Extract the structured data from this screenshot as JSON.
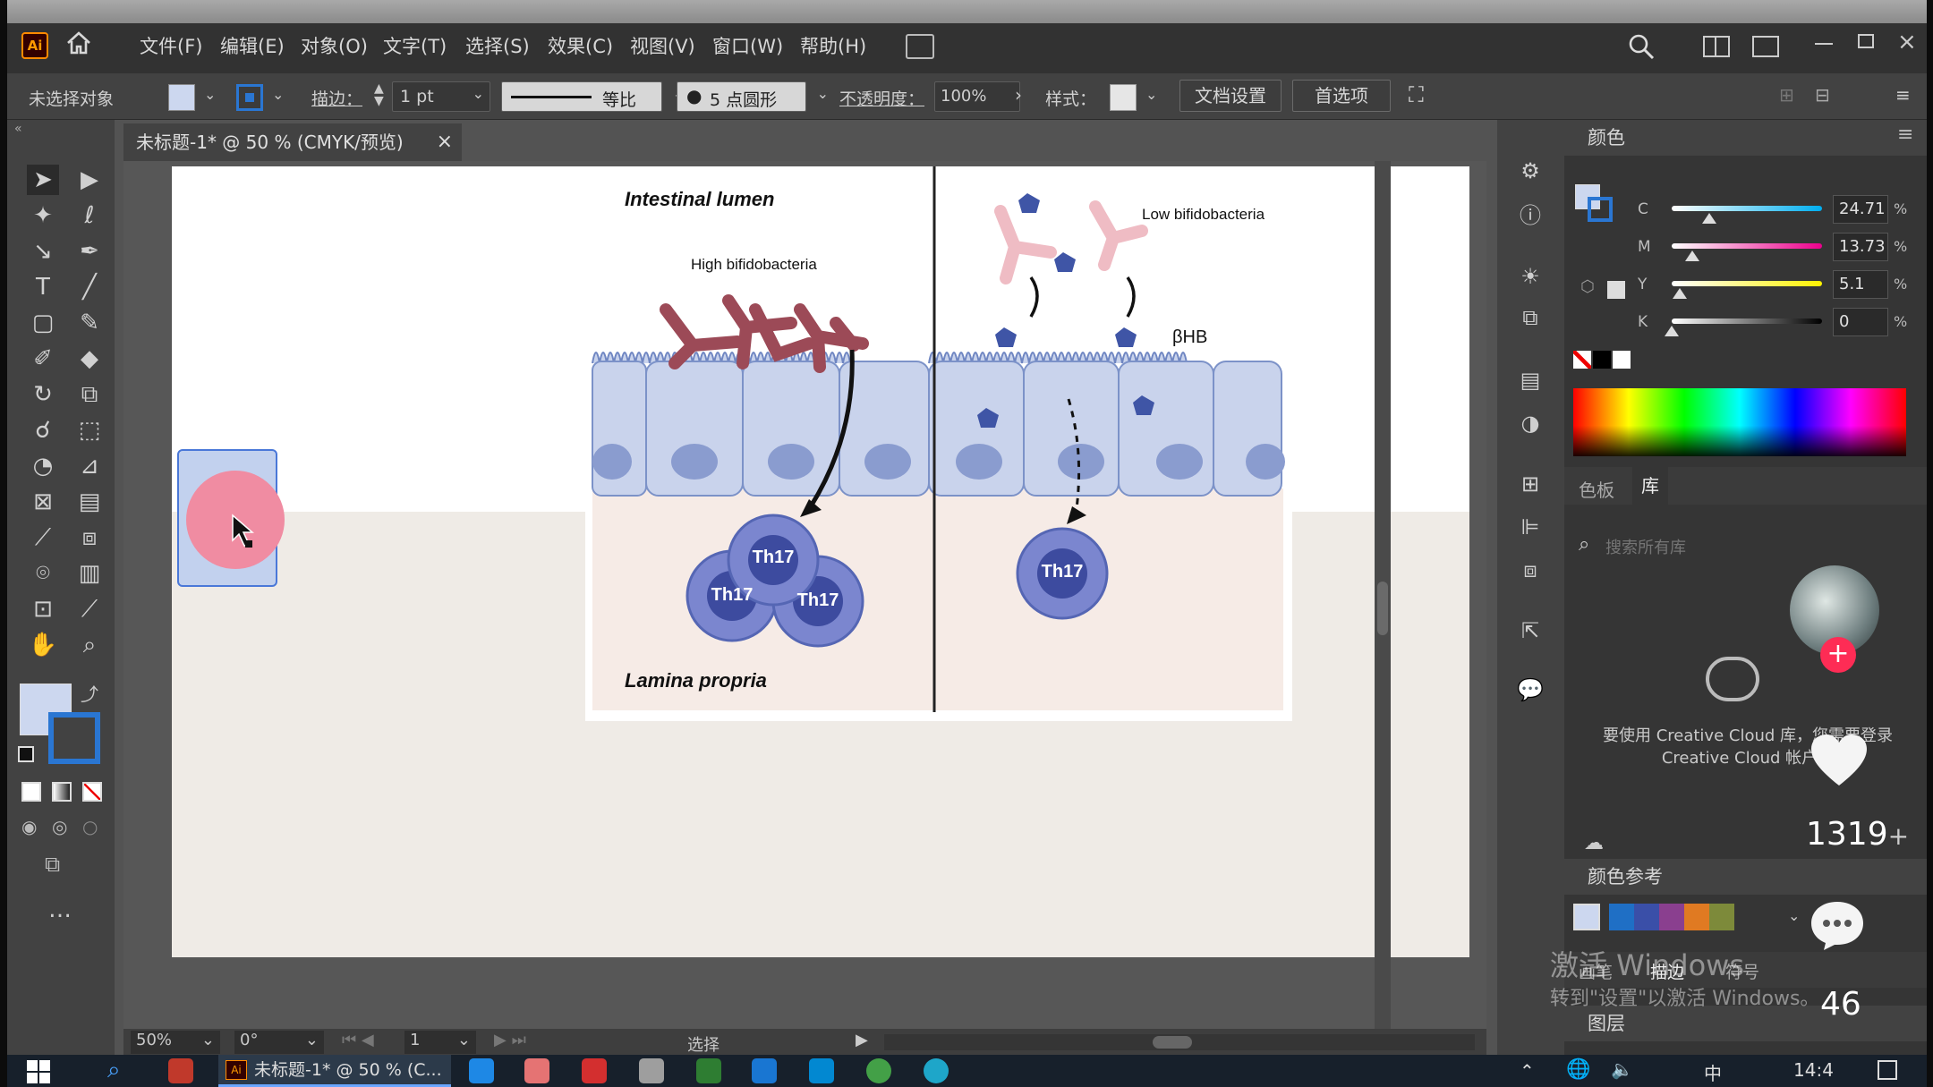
{
  "app": {
    "logo": "Ai",
    "menus": [
      "文件(F)",
      "编辑(E)",
      "对象(O)",
      "文字(T)",
      "选择(S)",
      "效果(C)",
      "视图(V)",
      "窗口(W)",
      "帮助(H)"
    ]
  },
  "control_bar": {
    "selection_label": "未选择对象",
    "stroke_label": "描边：",
    "stroke_value": "1 pt",
    "stroke_profile": "等比",
    "brush_label": "5 点圆形",
    "opacity_label": "不透明度：",
    "opacity_value": "100%",
    "style_label": "样式：",
    "doc_setup_button": "文档设置",
    "prefs_button": "首选项"
  },
  "document": {
    "tab_title": "未标题-1* @ 50 % (CMYK/预览)",
    "tab_close": "×"
  },
  "figure": {
    "top_label": "Intestinal lumen",
    "bottom_label": "Lamina propria",
    "left_condition": "High bifidobacteria",
    "right_condition": "Low bifidobacteria",
    "metabolite": "βHB",
    "cell_label": "Th17"
  },
  "status_bar": {
    "zoom": "50%",
    "rotation": "0°",
    "artboard": "1",
    "tool_status": "选择"
  },
  "color_panel": {
    "title": "颜色",
    "channels": [
      {
        "label": "C",
        "value": "24.71",
        "level": 0.2471,
        "gradient": [
          "#ffffff",
          "#00aeef"
        ]
      },
      {
        "label": "M",
        "value": "13.73",
        "level": 0.1373,
        "gradient": [
          "#ffffff",
          "#ec008c"
        ]
      },
      {
        "label": "Y",
        "value": "5.1",
        "level": 0.051,
        "gradient": [
          "#ffffff",
          "#fff200"
        ]
      },
      {
        "label": "K",
        "value": "0",
        "level": 0,
        "gradient": [
          "#ffffff",
          "#000000"
        ]
      }
    ],
    "percent": "%"
  },
  "library_panel": {
    "tabs": [
      "色板",
      "库"
    ],
    "search_placeholder": "搜索所有库",
    "message": "要使用 Creative Cloud 库，您需要登录 Creative Cloud 帐户。"
  },
  "color_guide": {
    "title": "颜色参考",
    "swatches": [
      "#1f6fc5",
      "#3a4fa8",
      "#8a3f8f",
      "#e07a22",
      "#7d8a3a"
    ]
  },
  "lower_panel": {
    "tabs": [
      "画笔",
      "描边",
      "符号"
    ],
    "layers_title": "图层"
  },
  "overlays": {
    "like_count": "1319",
    "plus": "+",
    "comment_count": "46",
    "activation_title": "激活 Windows",
    "activation_subtitle": "转到\"设置\"以激活 Windows。"
  },
  "taskbar": {
    "app_label": "未标题-1* @ 50 % (C...",
    "ime": "中",
    "clock": "14:4"
  },
  "colors": {
    "accent_pink": "#f08ca2",
    "fill_swatch": "#ccd7ef",
    "stroke_swatch": "#2a76d2",
    "th17_cell": "#6f7cc9",
    "bacteria_high": "#9c4a57",
    "bacteria_low": "#efbcc4",
    "pentagon": "#3f55a6"
  }
}
